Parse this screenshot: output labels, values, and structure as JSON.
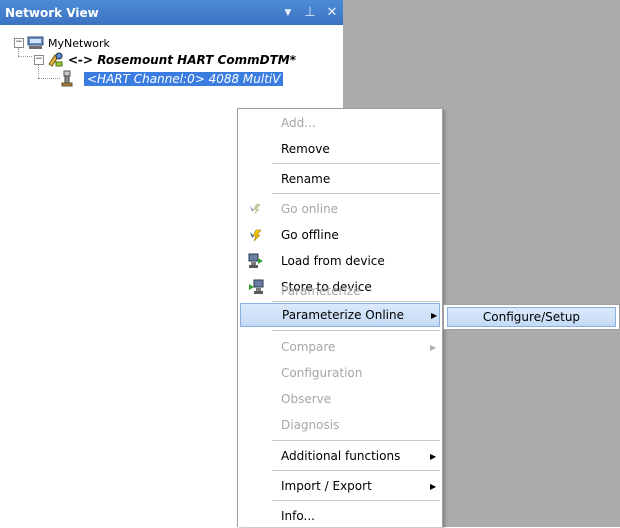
{
  "panel": {
    "title": "Network View",
    "controls": {
      "dropdown": "▼",
      "pin": "⊥",
      "close": "✕"
    }
  },
  "tree": {
    "root": {
      "label": "MyNetwork",
      "expander": "−"
    },
    "comm_dtm": {
      "label": "<-> Rosemount HART CommDTM*",
      "expander": "−"
    },
    "channel": {
      "label": "<HART Channel:0> 4088 MultiV"
    }
  },
  "context_menu": {
    "items": [
      {
        "label": "Add...",
        "disabled": true
      },
      {
        "label": "Remove",
        "disabled": false
      },
      {
        "label": "Rename",
        "disabled": false
      },
      {
        "label": "Go online",
        "disabled": true,
        "icon": "go-online-icon"
      },
      {
        "label": "Go offline",
        "disabled": false,
        "icon": "go-offline-icon"
      },
      {
        "label": "Load from device",
        "disabled": false,
        "icon": "load-from-device-icon"
      },
      {
        "label": "Store to device",
        "disabled": false,
        "icon": "store-to-device-icon"
      },
      {
        "label": "Parameterize",
        "disabled": true
      },
      {
        "label": "Parameterize Online",
        "disabled": false,
        "highlighted": true,
        "submenu": true
      },
      {
        "label": "Compare",
        "disabled": true,
        "submenu": true
      },
      {
        "label": "Configuration",
        "disabled": true
      },
      {
        "label": "Observe",
        "disabled": true
      },
      {
        "label": "Diagnosis",
        "disabled": true
      },
      {
        "label": "Additional functions",
        "disabled": false,
        "submenu": true
      },
      {
        "label": "Import / Export",
        "disabled": false,
        "submenu": true
      },
      {
        "label": "Info...",
        "disabled": false
      }
    ],
    "submenu_arrow": "▶"
  },
  "submenu": {
    "items": [
      {
        "label": "Configure/Setup",
        "highlighted": true
      }
    ]
  },
  "colors": {
    "title_bar": "#3f7ccb",
    "selection": "#3a7ce0",
    "menu_hover": "#c4dbf6",
    "disabled_text": "#a6a6a6",
    "workspace_gray": "#ababab"
  }
}
